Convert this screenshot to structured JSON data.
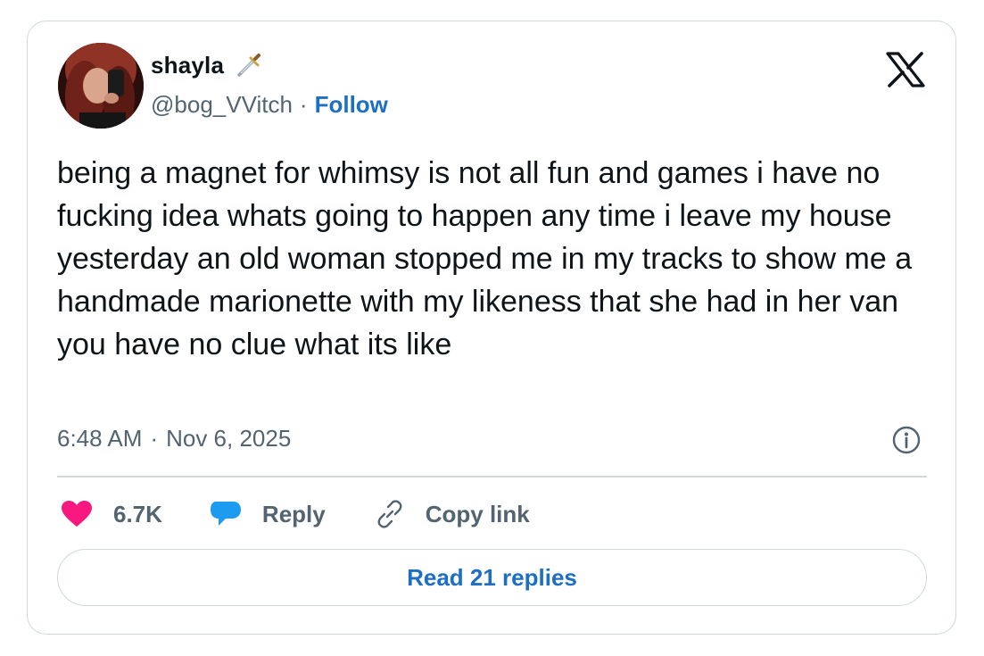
{
  "author": {
    "display_name": "shayla",
    "handle": "@bog_VVitch",
    "separator": "·",
    "follow_label": "Follow",
    "emoji_icon": "dagger-icon"
  },
  "tweet": {
    "text": "being a magnet for whimsy is not all fun and games i have no fucking idea whats going to happen any time i leave my house\nyesterday an old woman stopped me in my tracks to show me a handmade marionette with my likeness that she had in her van you have no clue what its like",
    "time": "6:48 AM",
    "separator": "·",
    "date": "Nov 6, 2025"
  },
  "actions": {
    "likes_count": "6.7K",
    "reply_label": "Reply",
    "copy_link_label": "Copy link"
  },
  "read_replies_label": "Read 21 replies",
  "colors": {
    "like": "#f91880",
    "reply": "#1d9bf0",
    "link": "#1d6fc4",
    "muted": "#536471"
  }
}
